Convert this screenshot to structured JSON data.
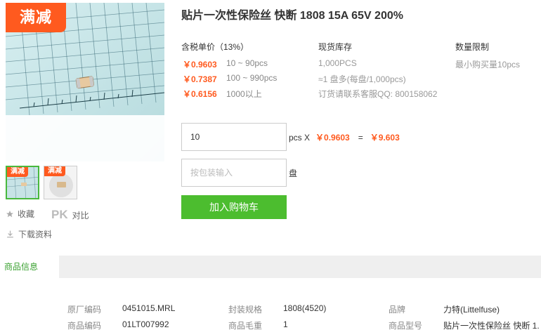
{
  "product": {
    "title": "贴片一次性保险丝 快断 1808 15A 65V 200%",
    "promo_badge": "满减",
    "thumb_badge": "满减"
  },
  "sidebar_actions": {
    "favorite_label": "收藏",
    "pk_logo": "PK",
    "compare_label": "对比",
    "download_label": "下载资料"
  },
  "pricing": {
    "header": "含税单价（13%）",
    "tiers": [
      {
        "price": "￥0.9603",
        "range": "10 ~ 90pcs"
      },
      {
        "price": "￥0.7387",
        "range": "100 ~ 990pcs"
      },
      {
        "price": "￥0.6156",
        "range": "1000以上"
      }
    ]
  },
  "stock": {
    "header": "现货库存",
    "quantity": "1,000PCS",
    "reel": "≈1 盘多(每盘/1,000pcs)",
    "order_note": "订货请联系客服QQ: 800158062"
  },
  "limit": {
    "header": "数量限制",
    "text": "最小购买量10pcs"
  },
  "order": {
    "qty_value": "10",
    "unit_x": "pcs X",
    "unit_price": "￥0.9603",
    "equals": "=",
    "total": "￥9.603",
    "reel_placeholder": "按包装输入",
    "reel_unit": "盘",
    "add_to_cart": "加入购物车"
  },
  "tabs": {
    "active": "商品信息"
  },
  "specs": {
    "row1": [
      {
        "key": "原厂编码",
        "value": "0451015.MRL"
      },
      {
        "key": "封装规格",
        "value": "1808(4520)"
      },
      {
        "key": "品牌",
        "value": "力特(Littelfuse)"
      }
    ],
    "row2": [
      {
        "key": "商品编码",
        "value": "01LT007992"
      },
      {
        "key": "商品毛重",
        "value": "1"
      },
      {
        "key": "商品型号",
        "value": "贴片一次性保险丝 快断 1."
      }
    ]
  },
  "colors": {
    "accent_orange": "#ff5a1f",
    "accent_green": "#4cbd2f",
    "tab_green": "#3aa130"
  },
  "icons": [
    "star-icon",
    "download-icon"
  ]
}
